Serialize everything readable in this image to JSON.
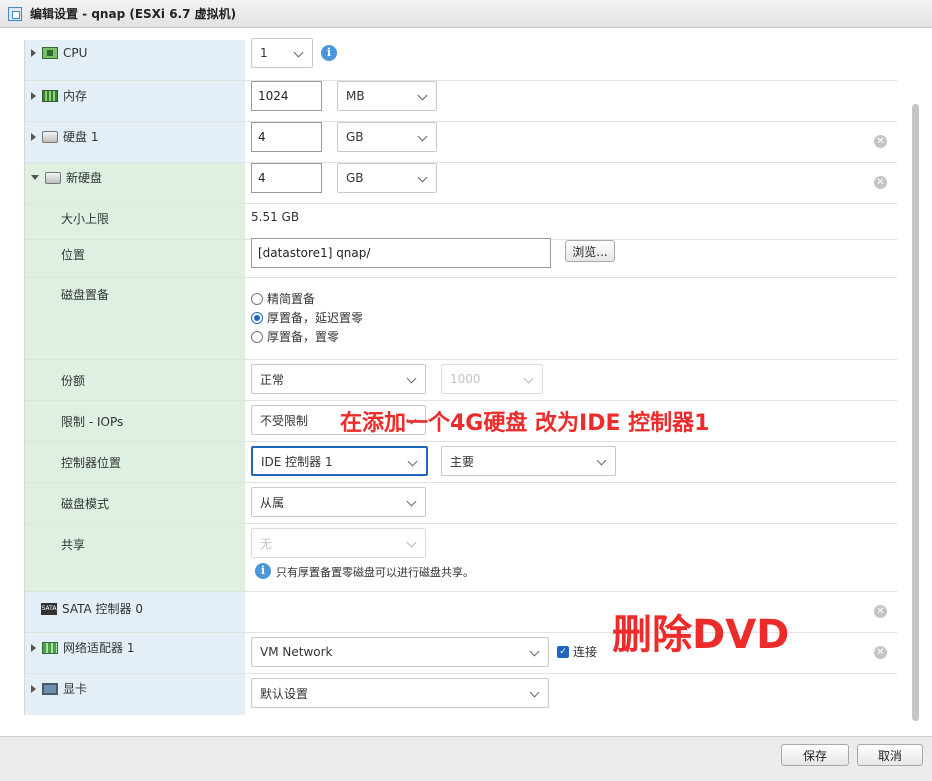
{
  "window": {
    "title": "编辑设置 - qnap (ESXi 6.7 虚拟机)"
  },
  "rows": {
    "cpu": {
      "label": "CPU",
      "value": "1"
    },
    "memory": {
      "label": "内存",
      "value": "1024",
      "unit": "MB"
    },
    "disk1": {
      "label": "硬盘 1",
      "value": "4",
      "unit": "GB"
    },
    "newdisk": {
      "label": "新硬盘",
      "value": "4",
      "unit": "GB"
    },
    "maxsize": {
      "label": "大小上限",
      "value": "5.51 GB"
    },
    "location": {
      "label": "位置",
      "value": "[datastore1] qnap/",
      "browse": "浏览..."
    },
    "provision": {
      "label": "磁盘置备",
      "options": [
        "精简置备",
        "厚置备，延迟置零",
        "厚置备，置零"
      ],
      "selected": 1
    },
    "shares": {
      "label": "份额",
      "value": "正常",
      "value2": "1000"
    },
    "limit": {
      "label": "限制 - IOPs",
      "value": "不受限制"
    },
    "controller": {
      "label": "控制器位置",
      "value": "IDE 控制器 1",
      "value2": "主要"
    },
    "diskmode": {
      "label": "磁盘模式",
      "value": "从属"
    },
    "sharing": {
      "label": "共享",
      "value": "无",
      "note": "只有厚置备置零磁盘可以进行磁盘共享。"
    },
    "sata": {
      "label": "SATA 控制器 0"
    },
    "network": {
      "label": "网络适配器 1",
      "value": "VM Network",
      "connect": "连接"
    },
    "display": {
      "label": "显卡",
      "value": "默认设置"
    }
  },
  "annotations": {
    "ide": "在添加一个4G硬盘 改为IDE  控制器1",
    "dvd": "删除DVD",
    "color": "#ee2b2b"
  },
  "footer": {
    "save": "保存",
    "cancel": "取消"
  },
  "icons": {
    "info": "info-icon",
    "remove": "remove-icon"
  }
}
